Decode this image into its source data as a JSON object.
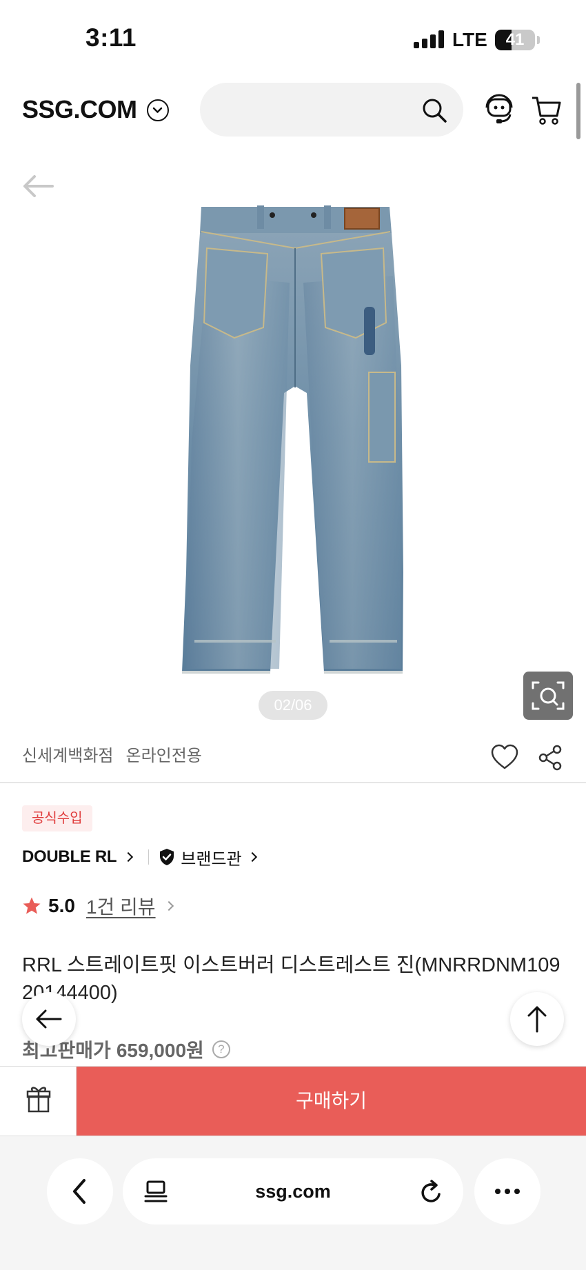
{
  "status_bar": {
    "time": "3:11",
    "network": "LTE",
    "battery": "41",
    "battery_level": 0.41
  },
  "header": {
    "logo": "SSG.COM",
    "search_placeholder": ""
  },
  "gallery": {
    "indicator": "02/06"
  },
  "seller": {
    "store": "신세계백화점",
    "channel": "온라인전용"
  },
  "product": {
    "badge": "공식수입",
    "brand": "DOUBLE RL",
    "brand_shop": "브랜드관",
    "rating": "5.0",
    "reviews": "1건 리뷰",
    "rating_value": 5.0,
    "title": "RRL 스트레이트핏 이스트버러 디스트레스트 진(MNRRDNM10920144400)",
    "price_label": "최고판매가",
    "price": "659,000원",
    "help": "?"
  },
  "purchase": {
    "buy_label": "구매하기"
  },
  "browser": {
    "url": "ssg.com"
  },
  "colors": {
    "accent": "#e95d58",
    "badge_bg": "#fdeeee",
    "badge_text": "#e03c3c",
    "star": "#e95d58"
  }
}
